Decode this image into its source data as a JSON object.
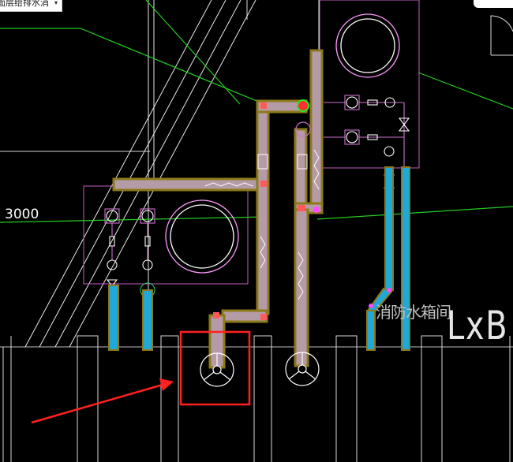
{
  "toolbar": {
    "layer_selector_value": "面层给排水消",
    "layer_selector_arrow": "▾"
  },
  "drawing": {
    "dimension_label": "3000",
    "room_label": "消防水箱间",
    "room_code": "LxB"
  },
  "colors": {
    "background": "#000000",
    "axis_line": "#00cc33",
    "green_line": "#1fcf1f",
    "outline_magenta": "#c060c0",
    "pipe_fill": "#b59aa8",
    "pipe_border": "#9c8a2e",
    "pipe_blue": "#1fa8d8",
    "valve_red": "#ff5050",
    "highlight_red": "#ff2020",
    "white": "#ffffff"
  },
  "icons": {
    "floor_drain": "floor-drain-icon",
    "water_tank": "water-tank-icon",
    "pump": "pump-icon",
    "valve": "valve-icon"
  }
}
